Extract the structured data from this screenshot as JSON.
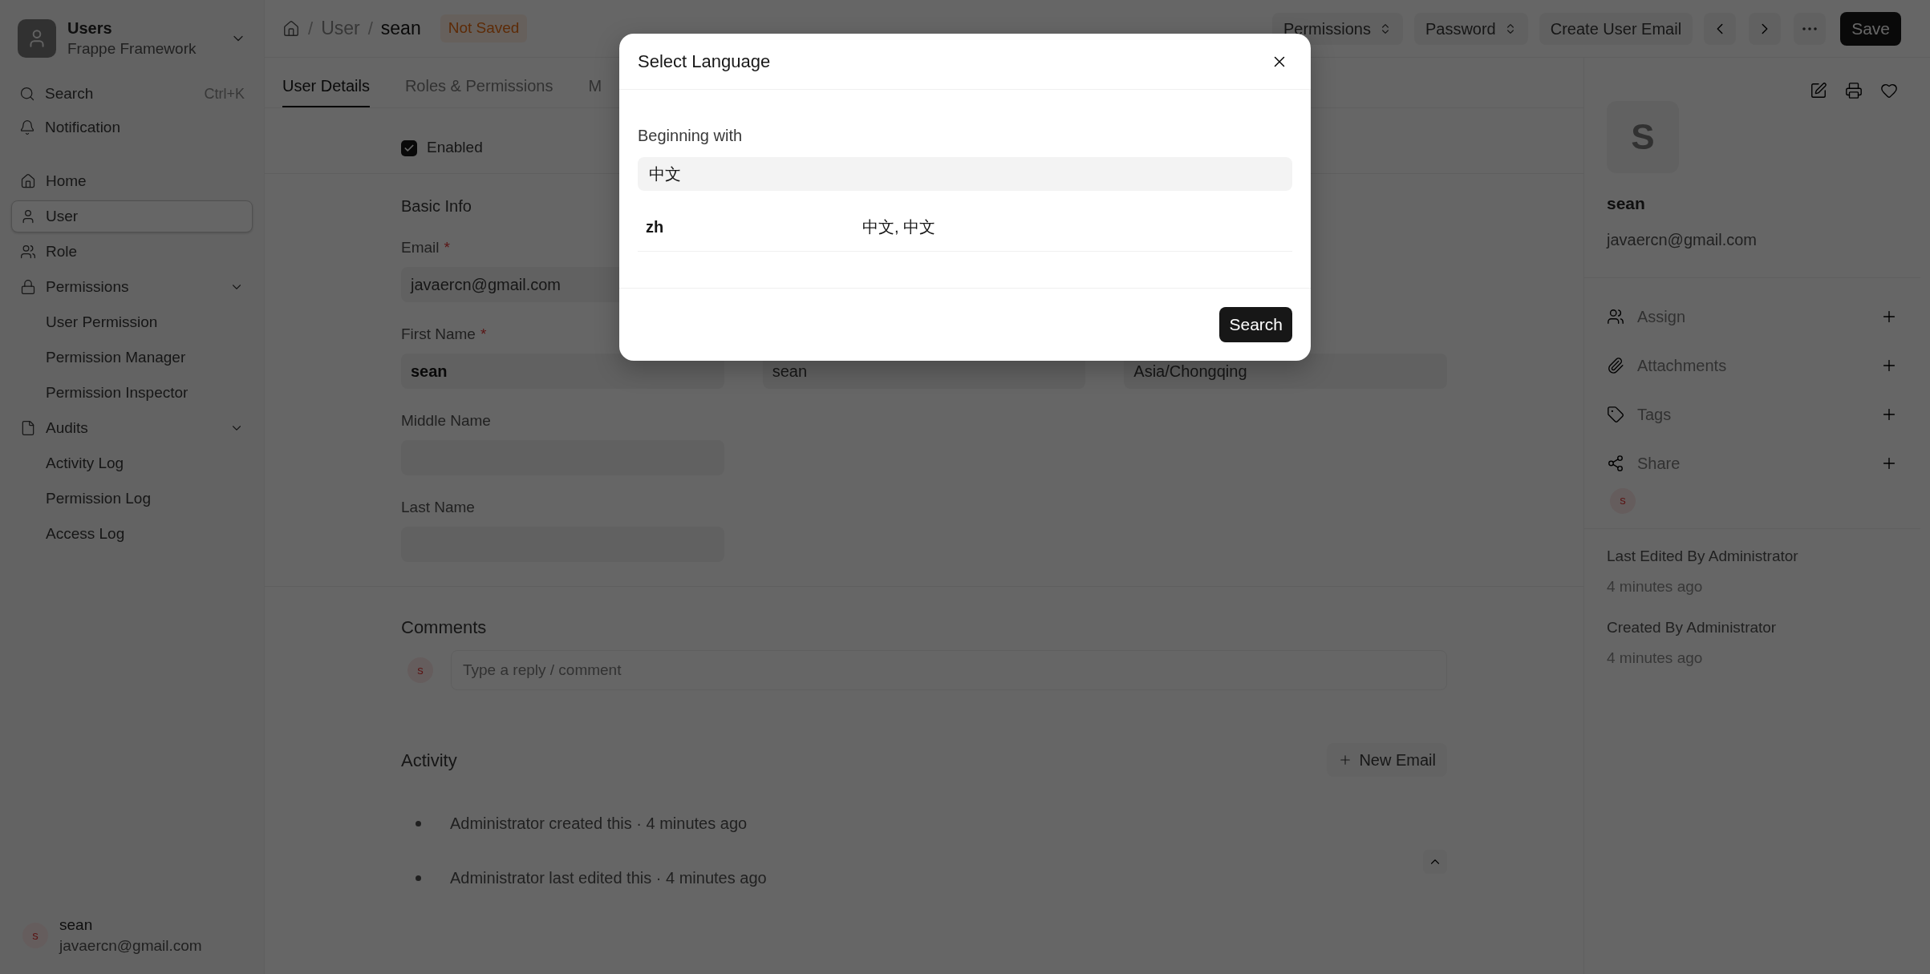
{
  "sidebar": {
    "app": {
      "title": "Users",
      "subtitle": "Frappe Framework"
    },
    "search": {
      "label": "Search",
      "shortcut": "Ctrl+K"
    },
    "notification": "Notification",
    "items": [
      {
        "label": "Home",
        "selected": false
      },
      {
        "label": "User",
        "selected": true
      },
      {
        "label": "Role",
        "selected": false
      },
      {
        "label": "Permissions",
        "selected": false,
        "expanded": true,
        "children": [
          {
            "label": "User Permission",
            "selected": false
          },
          {
            "label": "Permission Manager",
            "selected": false
          },
          {
            "label": "Permission Inspector",
            "selected": false
          }
        ]
      },
      {
        "label": "Audits",
        "selected": false,
        "expanded": true,
        "children": [
          {
            "label": "Activity Log",
            "selected": false
          },
          {
            "label": "Permission Log",
            "selected": false
          },
          {
            "label": "Access Log",
            "selected": false
          }
        ]
      }
    ],
    "user": {
      "avatar": "s",
      "name": "sean",
      "email": "javaercn@gmail.com"
    }
  },
  "breadcrumb": [
    {
      "separator": "/",
      "label": "User"
    },
    {
      "separator": "/",
      "label": "sean"
    }
  ],
  "status_badge": "Not Saved",
  "actions": [
    {
      "label": "Permissions",
      "kind": "select"
    },
    {
      "label": "Password",
      "kind": "select"
    },
    {
      "label": "Create User Email",
      "kind": "plain"
    }
  ],
  "save_button": "Save",
  "tabs": [
    {
      "label": "User Details",
      "selected": true
    },
    {
      "label": "Roles & Permissions",
      "selected": false
    },
    {
      "label": "M",
      "selected": false
    }
  ],
  "form": {
    "enabled": {
      "label": "Enabled",
      "checked": true
    },
    "section": "Basic Info",
    "rows": [
      [
        {
          "label": "Email",
          "required": "*",
          "value": "javaercn@gmail.com"
        }
      ],
      [
        {
          "label": "First Name",
          "required": "*",
          "value": "sean",
          "bold": true
        },
        {
          "value": "sean",
          "bold": false
        },
        {
          "value": "Asia/Chongqing",
          "bold": false
        }
      ],
      [
        {
          "label": "Middle Name"
        }
      ],
      [
        {
          "label": "Last Name"
        }
      ]
    ]
  },
  "comments": {
    "title": "Comments",
    "avatar": "s",
    "placeholder": "Type a reply / comment"
  },
  "activity": {
    "title": "Activity",
    "new_email": "New Email",
    "items": [
      "Administrator created this · 4 minutes ago",
      "Administrator last edited this · 4 minutes ago"
    ]
  },
  "side_panel": {
    "avatar": "S",
    "name": "sean",
    "email": "javaercn@gmail.com",
    "items": [
      {
        "label": "Assign"
      },
      {
        "label": "Attachments"
      },
      {
        "label": "Tags"
      },
      {
        "label": "Share"
      }
    ],
    "share_avatar": "s",
    "meta": [
      {
        "text": "Last Edited By Administrator",
        "time": "4 minutes ago"
      },
      {
        "text": "Created By Administrator",
        "time": "4 minutes ago"
      }
    ]
  },
  "dialog": {
    "title": "Select Language",
    "label": "Beginning with",
    "value": "中文",
    "results": [
      {
        "code": "zh",
        "name": "中文, 中文"
      }
    ],
    "button": "Search"
  }
}
